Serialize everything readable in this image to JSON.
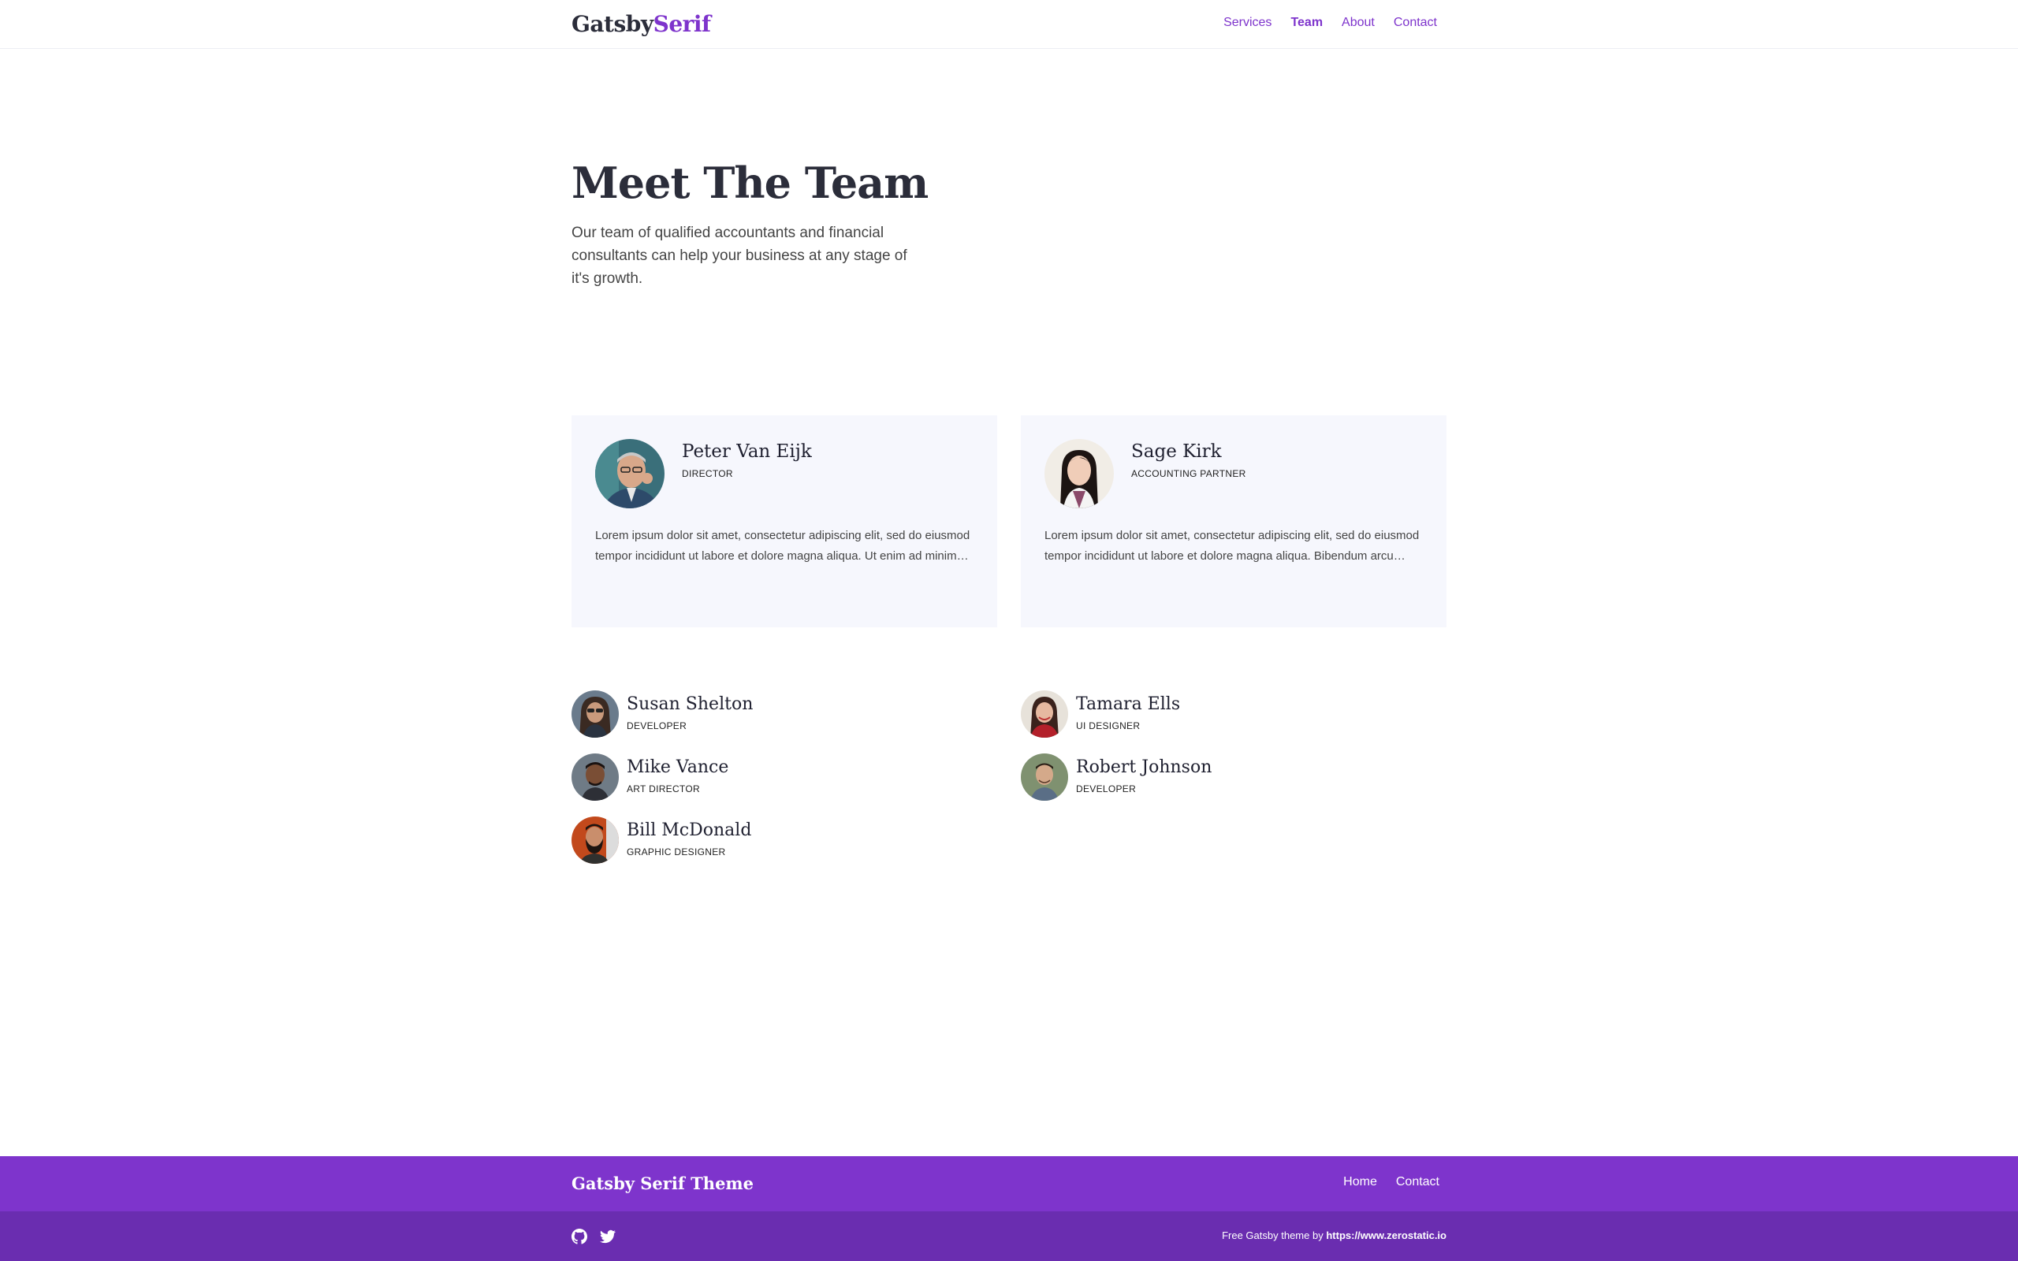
{
  "header": {
    "logo_main": "Gatsby",
    "logo_accent": "Serif",
    "nav": [
      {
        "label": "Services",
        "active": false
      },
      {
        "label": "Team",
        "active": true
      },
      {
        "label": "About",
        "active": false
      },
      {
        "label": "Contact",
        "active": false
      }
    ]
  },
  "hero": {
    "title": "Meet The Team",
    "description": "Our team of qualified accountants and financial consultants can help your business at any stage of it's growth."
  },
  "featured": [
    {
      "name": "Peter Van Eijk",
      "role": "Director",
      "bio": "Lorem ipsum dolor sit amet, consectetur adipiscing elit, sed do eiusmod tempor incididunt ut labore et dolore magna aliqua. Ut enim ad minim…"
    },
    {
      "name": "Sage Kirk",
      "role": "Accounting Partner",
      "bio": "Lorem ipsum dolor sit amet, consectetur adipiscing elit, sed do eiusmod tempor incididunt ut labore et dolore magna aliqua. Bibendum arcu…"
    }
  ],
  "members": [
    {
      "name": "Susan Shelton",
      "role": "Developer"
    },
    {
      "name": "Tamara Ells",
      "role": "UI Designer"
    },
    {
      "name": "Mike Vance",
      "role": "Art Director"
    },
    {
      "name": "Robert Johnson",
      "role": "Developer"
    },
    {
      "name": "Bill McDonald",
      "role": "Graphic Designer"
    }
  ],
  "footer": {
    "brand": "Gatsby Serif Theme",
    "nav": [
      "Home",
      "Contact"
    ],
    "credit_text": "Free Gatsby theme by",
    "credit_link": "https://www.zerostatic.io",
    "social_icons": [
      "github-icon",
      "twitter-icon"
    ]
  },
  "colors": {
    "accent": "#7e34cc",
    "footer_dark": "#6a2db0",
    "card_bg": "#f6f7fd",
    "heading": "#2b2d3a"
  }
}
